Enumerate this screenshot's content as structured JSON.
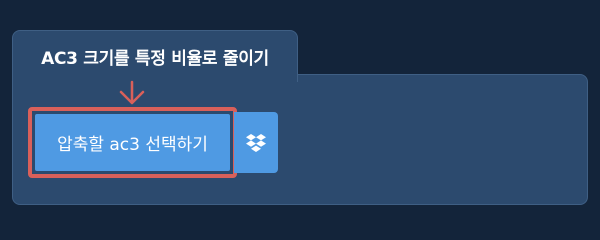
{
  "tool": {
    "title": "AC3 크기를 특정 비율로 줄이기"
  },
  "upload": {
    "choose_label": "압축할 ac3 선택하기",
    "dropbox_icon": "dropbox-icon"
  },
  "colors": {
    "page_background": "#13243a",
    "panel_background": "#2c4a6e",
    "button_blue": "#4f9ae3",
    "highlight_red": "#d9605a"
  }
}
